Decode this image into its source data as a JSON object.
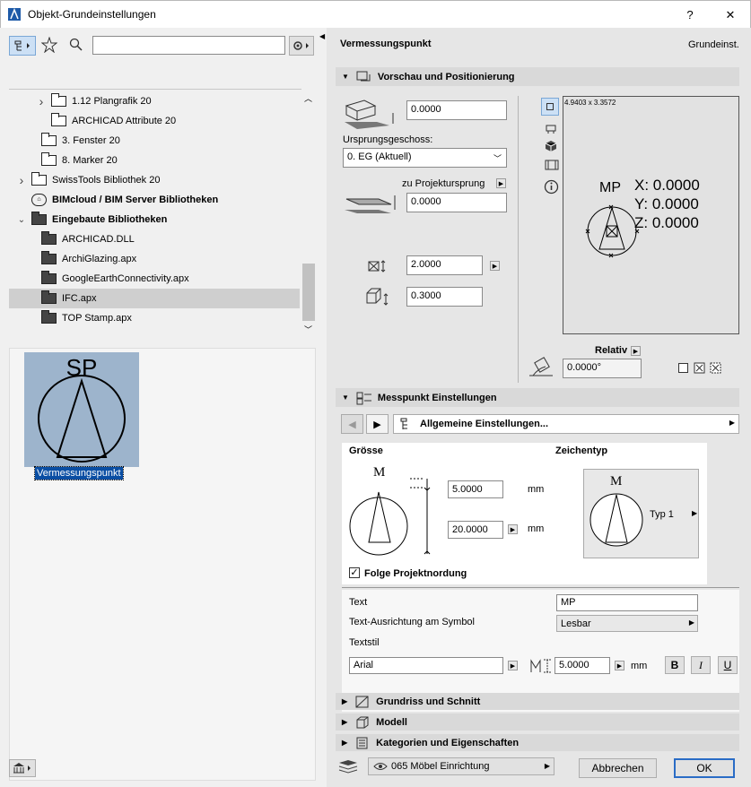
{
  "window": {
    "title": "Objekt-Grundeinstellungen",
    "help": "?",
    "close": "✕"
  },
  "left": {
    "search_placeholder": "",
    "tree": [
      {
        "label": "1.12 Plangrafik 20",
        "indent": 2,
        "chevron": ">",
        "dark": false
      },
      {
        "label": "ARCHICAD Attribute 20",
        "indent": 2,
        "chevron": "",
        "dark": false
      },
      {
        "label": "3. Fenster 20",
        "indent": 1,
        "chevron": "",
        "dark": false
      },
      {
        "label": "8. Marker 20",
        "indent": 1,
        "chevron": "",
        "dark": false
      },
      {
        "label": "SwissTools Bibliothek 20",
        "indent": 0,
        "chevron": ">",
        "dark": false
      },
      {
        "label": "BIMcloud / BIM Server Bibliotheken",
        "indent": 0,
        "chevron": "",
        "bold": true,
        "icon": "bim"
      },
      {
        "label": "Eingebaute Bibliotheken",
        "indent": 0,
        "chevron": "v",
        "bold": true,
        "dark": true
      },
      {
        "label": "ARCHICAD.DLL",
        "indent": 1,
        "dark": true
      },
      {
        "label": "ArchiGlazing.apx",
        "indent": 1,
        "dark": true
      },
      {
        "label": "GoogleEarthConnectivity.apx",
        "indent": 1,
        "dark": true
      },
      {
        "label": "IFC.apx",
        "indent": 1,
        "dark": true,
        "selected": true
      },
      {
        "label": "TOP Stamp.apx",
        "indent": 1,
        "dark": true
      }
    ],
    "preview_symbol": "SP",
    "preview_name": "Vermessungspunkt"
  },
  "right": {
    "object_name": "Vermessungspunkt",
    "mode_label": "Grundeinst.",
    "section_preview": "Vorschau und Positionierung",
    "elev_value": "0.0000",
    "origin_story_label": "Ursprungsgeschoss:",
    "origin_story_value": "0. EG (Aktuell)",
    "project_origin_label": "zu Projektursprung",
    "project_origin_value": "0.0000",
    "width_value": "2.0000",
    "height_value": "0.3000",
    "preview_dims": "4.9403 x 3.3572",
    "preview_mp": "MP",
    "preview_x": "X: 0.0000",
    "preview_y": "Y: 0.0000",
    "preview_z": "Z: 0.0000",
    "relativ_label": "Relativ",
    "angle_value": "0.0000°",
    "section_messpunkt": "Messpunkt Einstellungen",
    "page_selector": "Allgemeine Einstellungen...",
    "groesse_label": "Grösse",
    "zeichentyp_label": "Zeichentyp",
    "sym_letter": "M",
    "size1": "5.0000",
    "size2": "20.0000",
    "unit_mm": "mm",
    "typ_label": "Typ 1",
    "folge_label": "Folge Projektnordung",
    "text_label": "Text",
    "text_value": "MP",
    "ausrichtung_label": "Text-Ausrichtung am Symbol",
    "ausrichtung_value": "Lesbar",
    "textstil_label": "Textstil",
    "font_value": "Arial",
    "fontsize_value": "5.0000",
    "bold_btn": "B",
    "italic_btn": "I",
    "underline_btn": "U",
    "section_grundriss": "Grundriss und Schnitt",
    "section_modell": "Modell",
    "section_kategorien": "Kategorien und Eigenschaften",
    "layer_value": "065 Möbel Einrichtung",
    "cancel": "Abbrechen",
    "ok": "OK"
  }
}
